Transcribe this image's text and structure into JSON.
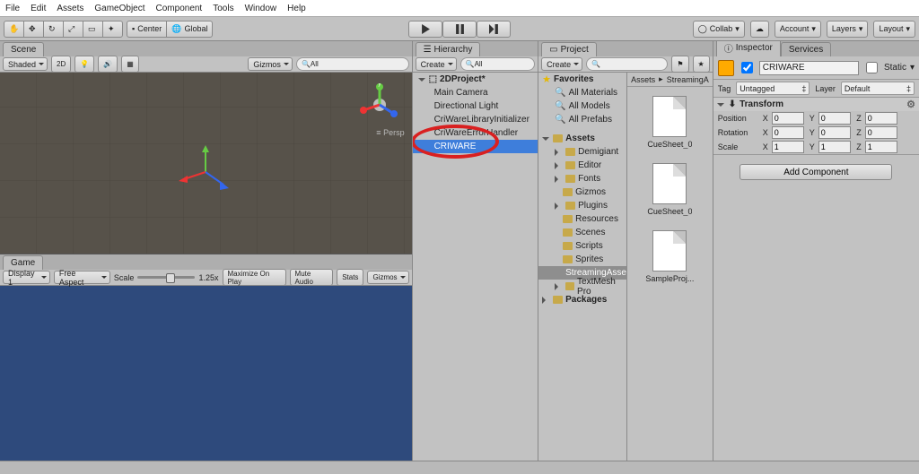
{
  "menu": {
    "items": [
      "File",
      "Edit",
      "Assets",
      "GameObject",
      "Component",
      "Tools",
      "Window",
      "Help"
    ]
  },
  "toolbar": {
    "center": "Center",
    "global": "Global",
    "collab": "Collab",
    "account": "Account",
    "layers": "Layers",
    "layout": "Layout"
  },
  "scene": {
    "tab": "Scene",
    "shaded": "Shaded",
    "twoD": "2D",
    "gizmos": "Gizmos",
    "all": "All",
    "persp": "Persp",
    "axis": {
      "x": "x",
      "y": "y",
      "z": "z"
    }
  },
  "game": {
    "tab": "Game",
    "display": "Display 1",
    "aspect": "Free Aspect",
    "scaleLabel": "Scale",
    "scaleVal": "1.25x",
    "maxOnPlay": "Maximize On Play",
    "muteAudio": "Mute Audio",
    "stats": "Stats",
    "gizmos": "Gizmos"
  },
  "hierarchy": {
    "tab": "Hierarchy",
    "create": "Create",
    "all": "All",
    "root": "2DProject*",
    "items": [
      "Main Camera",
      "Directional Light",
      "CriWareLibraryInitializer",
      "CriWareErrorHandler",
      "CRIWARE"
    ]
  },
  "project": {
    "tab": "Project",
    "create": "Create",
    "favorites": "Favorites",
    "favItems": [
      "All Materials",
      "All Models",
      "All Prefabs"
    ],
    "assets": "Assets",
    "assetItems": [
      "Demigiant",
      "Editor",
      "Fonts",
      "Gizmos",
      "Plugins",
      "Resources",
      "Scenes",
      "Scripts",
      "Sprites",
      "StreamingAssets",
      "TextMesh Pro"
    ],
    "packages": "Packages",
    "breadcrumb": [
      "Assets",
      "StreamingA"
    ],
    "thumbs": [
      "CueSheet_0",
      "CueSheet_0",
      "SampleProj..."
    ]
  },
  "inspector": {
    "tab": "Inspector",
    "services": "Services",
    "name": "CRIWARE",
    "staticLabel": "Static",
    "tag": "Tag",
    "tagVal": "Untagged",
    "layer": "Layer",
    "layerVal": "Default",
    "transform": "Transform",
    "position": "Position",
    "rotation": "Rotation",
    "scale": "Scale",
    "pos": [
      "0",
      "0",
      "0"
    ],
    "rot": [
      "0",
      "0",
      "0"
    ],
    "scl": [
      "1",
      "1",
      "1"
    ],
    "axes": [
      "X",
      "Y",
      "Z"
    ],
    "addComponent": "Add Component"
  }
}
